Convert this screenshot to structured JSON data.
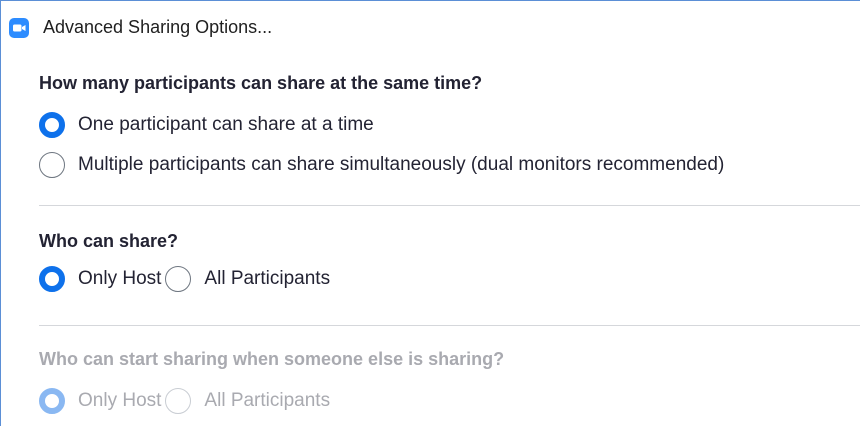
{
  "window": {
    "title": "Advanced Sharing Options...",
    "accent_color": "#2d8cff"
  },
  "sections": [
    {
      "heading": "How many participants can share at the same time?",
      "enabled": true,
      "options": [
        {
          "label": "One participant can share at a time",
          "selected": true
        },
        {
          "label": "Multiple participants can share simultaneously (dual monitors recommended)",
          "selected": false
        }
      ]
    },
    {
      "heading": "Who can share?",
      "enabled": true,
      "options": [
        {
          "label": "Only Host",
          "selected": true
        },
        {
          "label": "All Participants",
          "selected": false
        }
      ]
    },
    {
      "heading": "Who can start sharing when someone else is sharing?",
      "enabled": false,
      "options": [
        {
          "label": "Only Host",
          "selected": true
        },
        {
          "label": "All Participants",
          "selected": false
        }
      ]
    }
  ],
  "colors": {
    "radio_selected": "#0e71eb",
    "radio_selected_disabled": "#8ab8f2",
    "text": "#232333",
    "text_disabled": "#a9aab0",
    "divider": "#d5d7db"
  }
}
